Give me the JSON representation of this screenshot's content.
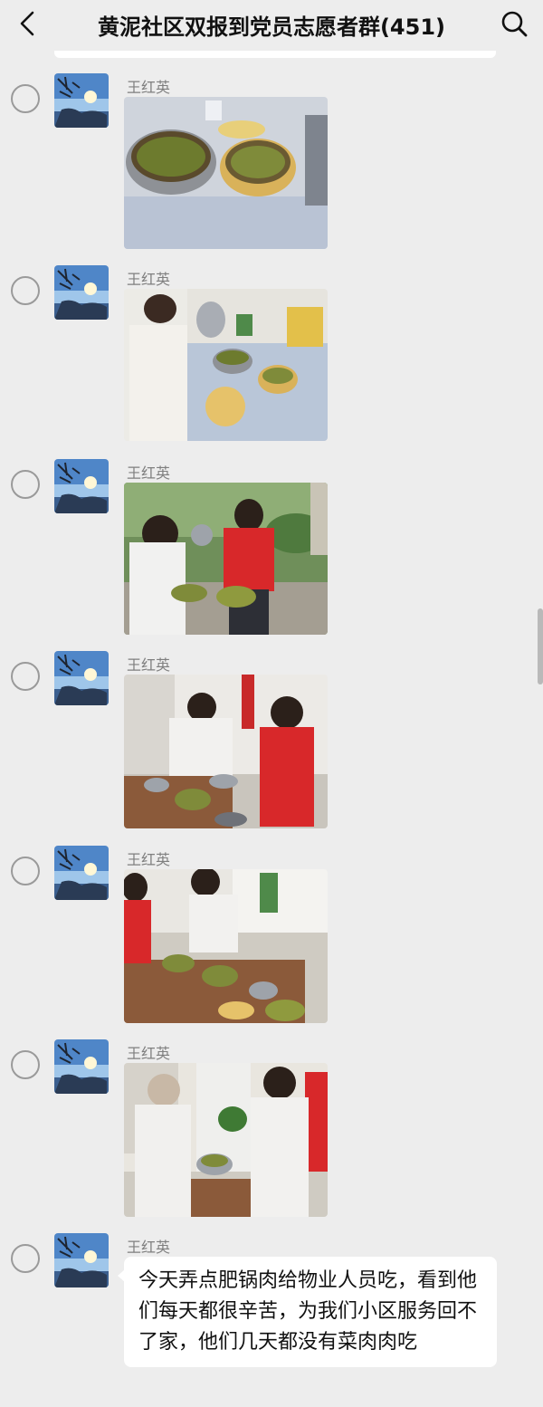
{
  "header": {
    "title": "黄泥社区双报到党员志愿者群(451)",
    "back_icon": "chevron-left-icon",
    "search_icon": "search-icon"
  },
  "messages": [
    {
      "sender": "王红英",
      "type": "image",
      "image_label": "food-pots-photo"
    },
    {
      "sender": "王红英",
      "type": "image",
      "image_label": "kitchen-serving-photo"
    },
    {
      "sender": "王红英",
      "type": "image",
      "image_label": "volunteers-outdoor-photo"
    },
    {
      "sender": "王红英",
      "type": "image",
      "image_label": "serving-indoor-photo"
    },
    {
      "sender": "王红英",
      "type": "image",
      "image_label": "volunteers-table-photo"
    },
    {
      "sender": "王红英",
      "type": "image",
      "image_label": "serving-staff-photo"
    },
    {
      "sender": "王红英",
      "type": "text",
      "text": "今天弄点肥锅肉给物业人员吃，看到他们每天都很辛苦，为我们小区服务回不了家，他们几天都没有菜肉肉吃"
    }
  ],
  "colors": {
    "background": "#ededed",
    "bubble": "#ffffff",
    "sender_name": "#7f7f7f",
    "volunteer_vest": "#d8282a"
  }
}
